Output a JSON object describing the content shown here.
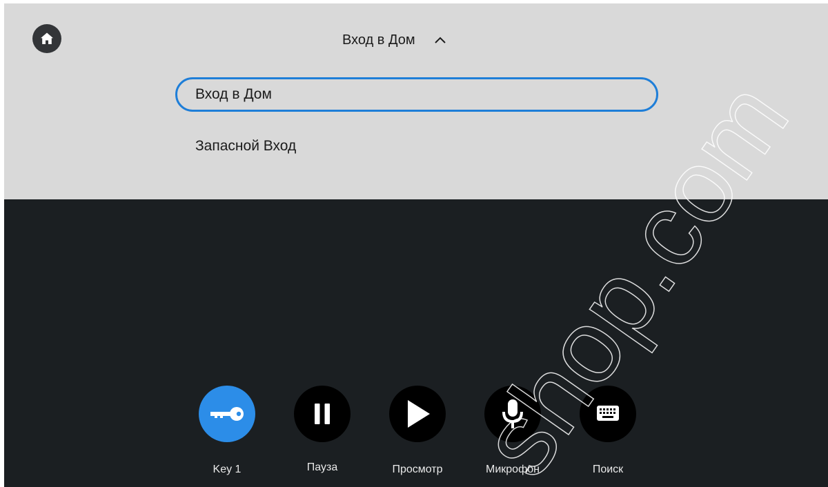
{
  "dropdown": {
    "selected": "Вход в Дом",
    "options": [
      "Вход в Дом",
      "Запасной Вход"
    ]
  },
  "controls": [
    {
      "label": "Key 1",
      "icon": "key-icon",
      "active": true
    },
    {
      "label": "Пауза",
      "icon": "pause-icon",
      "active": false
    },
    {
      "label": "Просмотр",
      "icon": "play-icon",
      "active": false
    },
    {
      "label": "Микрофон",
      "icon": "microphone-icon",
      "active": false
    },
    {
      "label": "Поиск",
      "icon": "keyboard-icon",
      "active": false
    }
  ],
  "watermark": "shop.com",
  "colors": {
    "panel": "#d9d9d9",
    "video_background": "#1b1f22",
    "accent": "#2c8de8",
    "selection_outline": "#1e7ed8",
    "button": "#000000"
  }
}
